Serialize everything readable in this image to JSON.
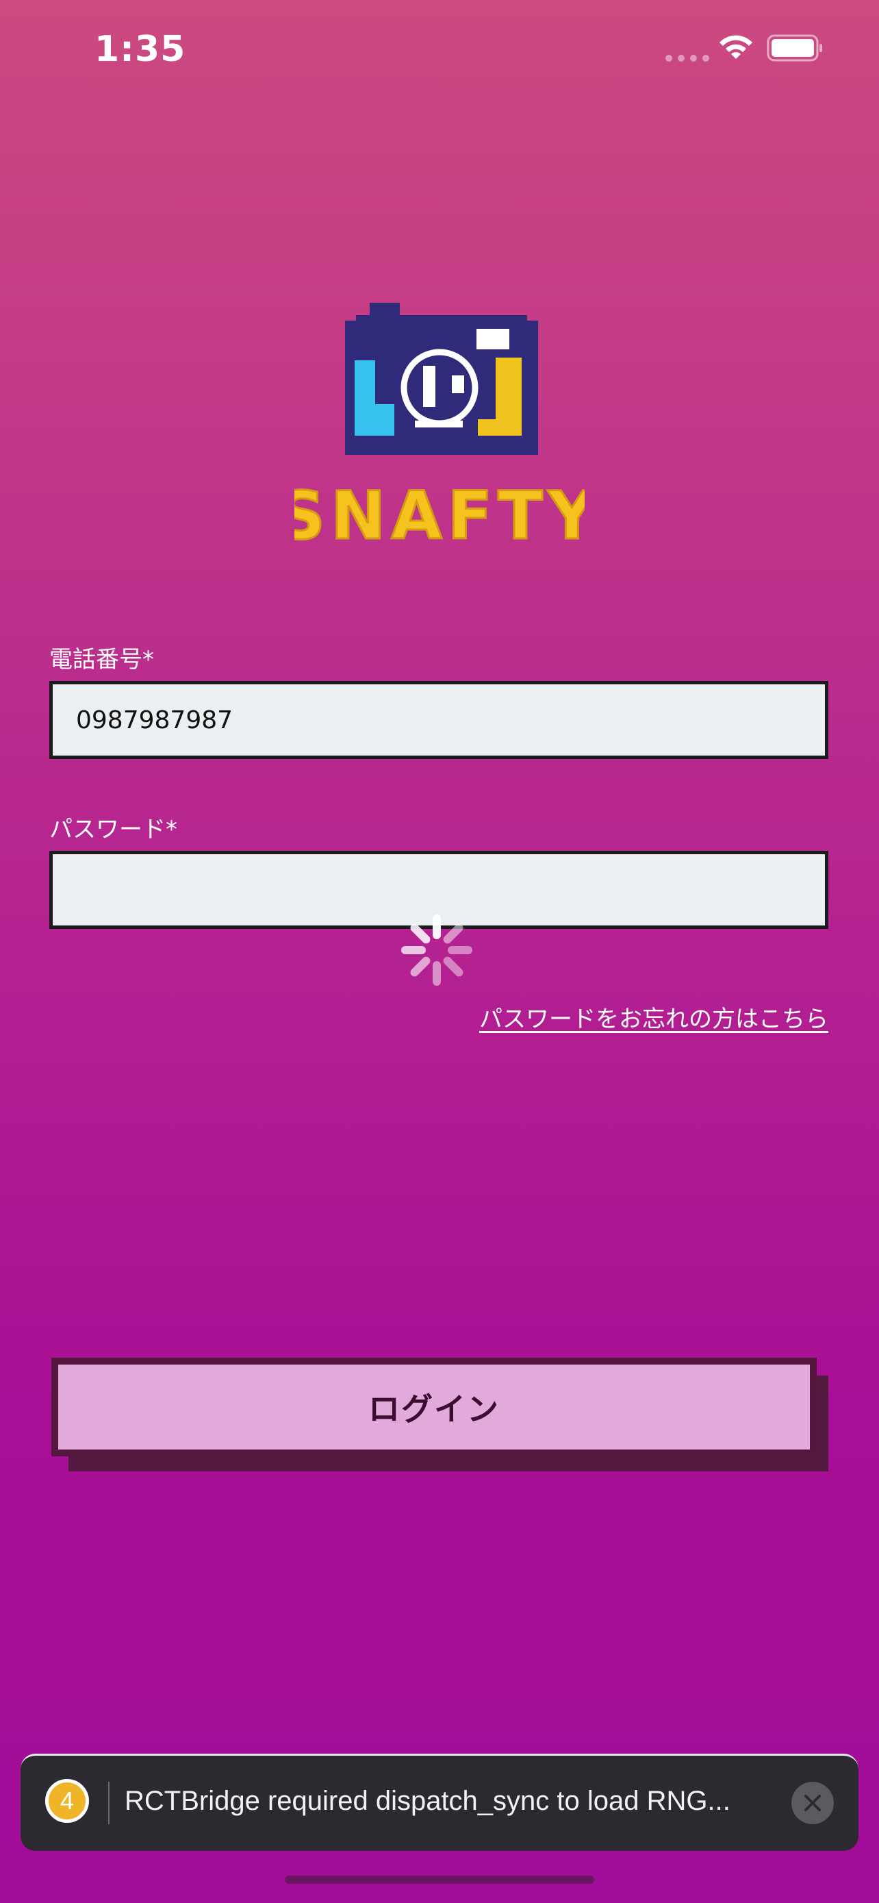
{
  "status_bar": {
    "time": "1:35",
    "icons": [
      "signal-dots-icon",
      "wifi-icon",
      "battery-icon"
    ]
  },
  "logo": {
    "text": "SNAFTY",
    "colors": {
      "camera": "#2f2a7a",
      "left_block": "#36c3ef",
      "right_block": "#f0c21e",
      "text_fill": "#f5c21e",
      "text_outline": "#e7b019"
    }
  },
  "form": {
    "phone_label": "電話番号*",
    "phone_value": "0987987987",
    "password_label": "パスワード*",
    "password_value": "",
    "forgot_link": "パスワードをお忘れの方はこちら",
    "login_button": "ログイン"
  },
  "toast": {
    "count": "4",
    "message": "RCTBridge required dispatch_sync to load RNG..."
  },
  "colors": {
    "bg_top": "#cc4a80",
    "bg_bottom": "#a00d98",
    "button_fill": "#e2aadb",
    "button_border": "#551640",
    "input_fill": "#eceff1",
    "toast_badge": "#f0b428"
  }
}
